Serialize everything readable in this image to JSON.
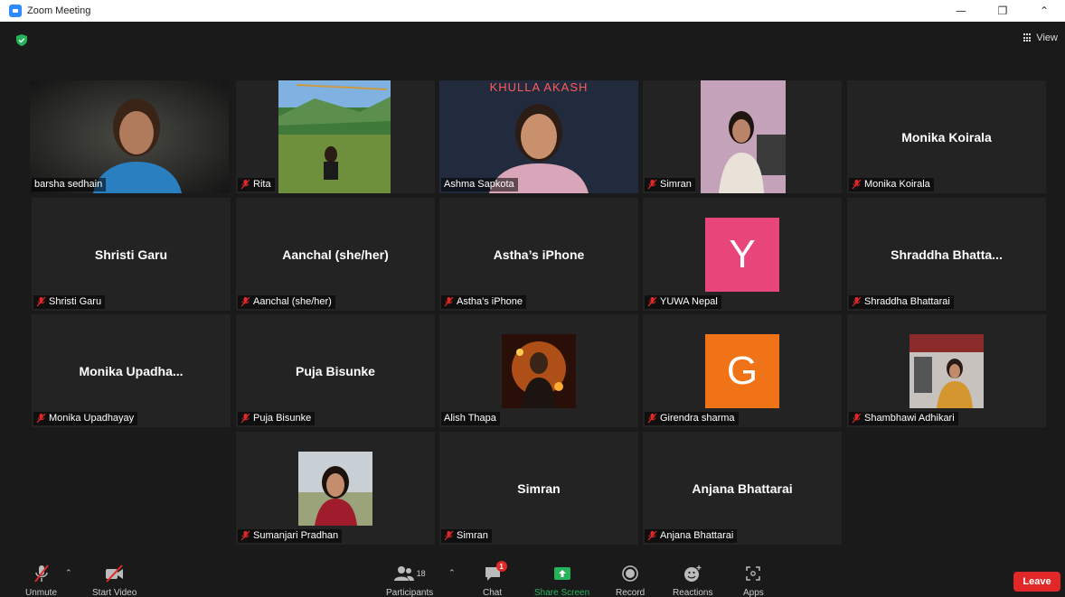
{
  "window": {
    "title": "Zoom Meeting"
  },
  "top": {
    "view_label": "View"
  },
  "participants": [
    {
      "name": "barsha sedhain",
      "display": "",
      "kind": "video"
    },
    {
      "name": "Rita",
      "display": "",
      "kind": "photo"
    },
    {
      "name": "Ashma Sapkota",
      "display": "KHULLA AKASH",
      "kind": "video"
    },
    {
      "name": "Simran",
      "display": "",
      "kind": "photo"
    },
    {
      "name": "Monika Koirala",
      "display": "Monika Koirala",
      "kind": "name"
    },
    {
      "name": "Shristi Garu",
      "display": "Shristi Garu",
      "kind": "name"
    },
    {
      "name": "Aanchal (she/her)",
      "display": "Aanchal (she/her)",
      "kind": "name"
    },
    {
      "name": "Astha's iPhone",
      "display": "Astha’s iPhone",
      "kind": "name"
    },
    {
      "name": "YUWA Nepal",
      "display": "Y",
      "kind": "avatar",
      "color": "#e8457a"
    },
    {
      "name": "Shraddha Bhattarai",
      "display": "Shraddha  Bhatta...",
      "kind": "name"
    },
    {
      "name": "Monika Upadhayay",
      "display": "Monika  Upadha...",
      "kind": "name"
    },
    {
      "name": "Puja Bisunke",
      "display": "Puja Bisunke",
      "kind": "name"
    },
    {
      "name": "Alish Thapa",
      "display": "",
      "kind": "photo"
    },
    {
      "name": "Girendra sharma",
      "display": "G",
      "kind": "avatar",
      "color": "#f07318"
    },
    {
      "name": "Shambhawi Adhikari",
      "display": "",
      "kind": "photo"
    },
    {
      "name": "Sumanjari Pradhan",
      "display": "",
      "kind": "photo"
    },
    {
      "name": "Simran",
      "display": "Simran",
      "kind": "name"
    },
    {
      "name": "Anjana Bhattarai",
      "display": "Anjana Bhattarai",
      "kind": "name"
    }
  ],
  "toolbar": {
    "unmute": "Unmute",
    "start_video": "Start Video",
    "participants": "Participants",
    "participants_count": "18",
    "chat": "Chat",
    "chat_badge": "1",
    "share_screen": "Share Screen",
    "record": "Record",
    "reactions": "Reactions",
    "apps": "Apps",
    "leave": "Leave"
  },
  "colors": {
    "active_speaker": "#d9e26a",
    "leave": "#e02828",
    "share": "#27b35b",
    "mute_red": "#e02828"
  }
}
